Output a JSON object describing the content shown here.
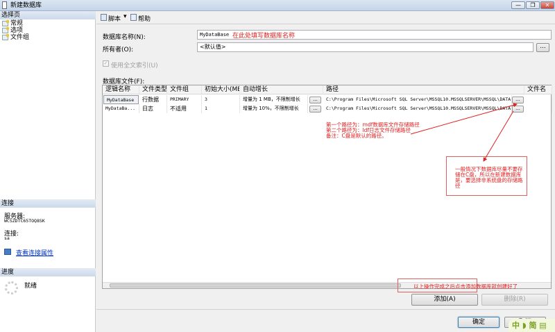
{
  "window": {
    "title": "新建数据库",
    "minimize": "—",
    "restore": "❐",
    "close": "✕"
  },
  "left": {
    "select_page_header": "选择页",
    "pages": [
      "常规",
      "选项",
      "文件组"
    ],
    "connection_header": "连接",
    "server_label": "服务器:",
    "server_value": "WCSZDTC65TOQ8SK",
    "connection_label": "连接:",
    "connection_value": "sa",
    "view_connection_link": "查看连接属性",
    "progress_header": "进度",
    "progress_status": "就绪"
  },
  "toolbar": {
    "script_label": "脚本",
    "dropdown": "▾",
    "help_label": "帮助"
  },
  "form": {
    "db_name_label": "数据库名称(N):",
    "db_name_value": "MyDataBase",
    "owner_label": "所有者(O):",
    "owner_value": "<默认值>",
    "browse": "...",
    "fulltext_label": "使用全文索引(U)",
    "db_files_label": "数据库文件(F):"
  },
  "table": {
    "columns": [
      "逻辑名称",
      "文件类型",
      "文件组",
      "初始大小(MB)",
      "自动增长",
      "路径",
      "文件名"
    ],
    "rows": [
      {
        "name": "MyDataBase",
        "type": "行数据",
        "group": "PRIMARY",
        "size": "3",
        "growth": "增量为 1 MB，不限制增长",
        "path": "C:\\Program Files\\Microsoft SQL Server\\MSSQL10.MSSQLSERVER\\MSSQL\\DATA",
        "file": ""
      },
      {
        "name": "MyDataBa...",
        "type": "日志",
        "group": "不适用",
        "size": "1",
        "growth": "增量为 10%，不限制增长",
        "path": "C:\\Program Files\\Microsoft SQL Server\\MSSQL10.MSSQLSERVER\\MSSQL\\DATA",
        "file": ""
      }
    ]
  },
  "buttons": {
    "add": "添加(A)",
    "remove": "删除(R)",
    "ok": "确定",
    "cancel": "取消"
  },
  "annotations": {
    "name_hint": "在此处填写数据库名称",
    "path_note": [
      "第一个路径为：mdf数据库文件存储路径",
      "第二个路径为：ldf日志文件存储路径",
      "备注：C盘是默认的路径。"
    ],
    "box_note": "一般情况下数据库尽量不要存储在C盘，所以在新建数据库是，要选择非系统盘的存储路径",
    "add_note": "以上操作完成之后点击添加数据库就创建好了"
  },
  "watermark": "中♪☽简▤",
  "colors": {
    "annotation": "#e02020",
    "link": "#0033cc"
  }
}
